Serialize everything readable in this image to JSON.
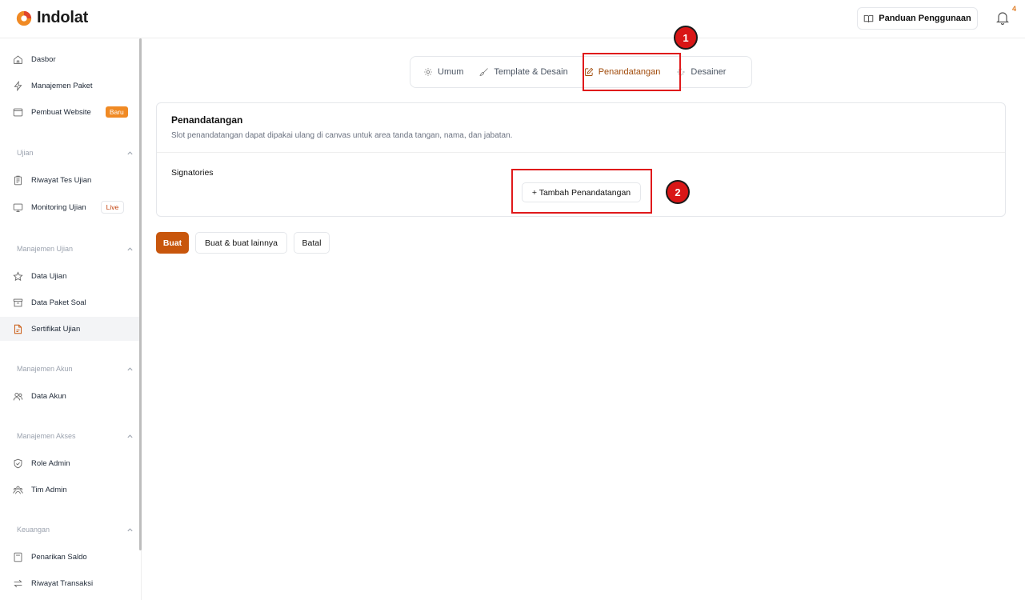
{
  "app": {
    "logo_text": "Indolat",
    "accent": "#c8560c",
    "brand_orange": "#f08a24"
  },
  "header": {
    "guide_label": "Panduan Penggunaan",
    "notification_count": "4"
  },
  "sidebar": {
    "items": {
      "dasbor": "Dasbor",
      "manajemen_paket": "Manajemen Paket",
      "pembuat_website": "Pembuat Website",
      "pembuat_website_badge": "Baru",
      "riwayat_tes": "Riwayat Tes Ujian",
      "monitoring": "Monitoring Ujian",
      "monitoring_badge": "Live",
      "data_ujian": "Data Ujian",
      "data_paket_soal": "Data Paket Soal",
      "sertifikat": "Sertifikat Ujian",
      "data_akun": "Data Akun",
      "role_admin": "Role Admin",
      "tim_admin": "Tim Admin",
      "penarikan_saldo": "Penarikan Saldo",
      "riwayat_transaksi": "Riwayat Transaksi"
    },
    "sections": {
      "ujian": "Ujian",
      "manajemen_ujian": "Manajemen Ujian",
      "manajemen_akun": "Manajemen Akun",
      "manajemen_akses": "Manajemen Akses",
      "keuangan": "Keuangan"
    }
  },
  "tabs": [
    {
      "label": "Umum",
      "icon": "gear-icon"
    },
    {
      "label": "Template & Desain",
      "icon": "brush-icon"
    },
    {
      "label": "Penandatangan",
      "icon": "edit-icon",
      "active": true
    },
    {
      "label": "Desainer",
      "icon": "sparkle-icon"
    }
  ],
  "card": {
    "title": "Penandatangan",
    "description": "Slot penandatangan dapat dipakai ulang di canvas untuk area tanda tangan, nama, dan jabatan.",
    "signatories_label": "Signatories",
    "add_button": "+ Tambah Penandatangan"
  },
  "actions": {
    "create": "Buat",
    "create_more": "Buat & buat lainnya",
    "cancel": "Batal"
  },
  "annotations": {
    "one": "1",
    "two": "2",
    "color": "#e0191b"
  }
}
